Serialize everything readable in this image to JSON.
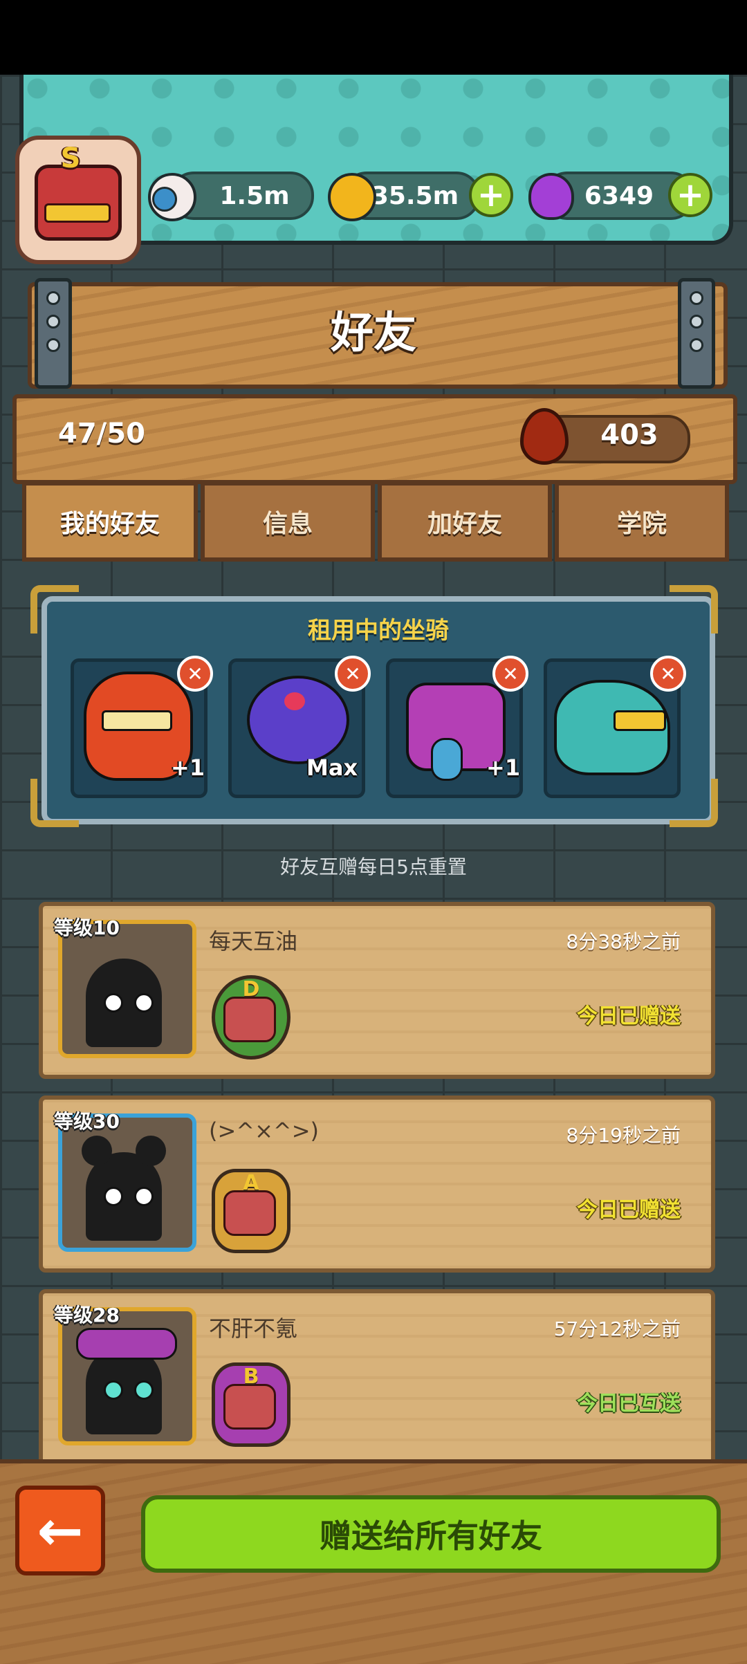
{
  "resources": {
    "eye_value": "1.5m",
    "gold_value": "35.5m",
    "potion_value": "6349"
  },
  "player": {
    "rank": "S"
  },
  "header": {
    "title": "好友"
  },
  "friends_count": "47/50",
  "blood_value": "403",
  "tabs": [
    {
      "label": "我的好友",
      "active": true
    },
    {
      "label": "信息",
      "active": false
    },
    {
      "label": "加好友",
      "active": false
    },
    {
      "label": "学院",
      "active": false
    }
  ],
  "rented_mounts": {
    "title": "租用中的坐骑",
    "mounts": [
      {
        "name": "lion-dance-mount",
        "tag": "+1"
      },
      {
        "name": "purple-rose-mount",
        "tag": "Max"
      },
      {
        "name": "horned-purple-demon-mount",
        "tag": "+1"
      },
      {
        "name": "teal-dragon-mount",
        "tag": ""
      }
    ]
  },
  "reset_note": "好友互赠每日5点重置",
  "friends": [
    {
      "level": "等级10",
      "name": "每天互油",
      "time": "8分38秒之前",
      "status": "今日已赠送",
      "rank": "D",
      "status_color": "#f2e232"
    },
    {
      "level": "等级30",
      "name": "(>^×^>)",
      "time": "8分19秒之前",
      "status": "今日已赠送",
      "rank": "A",
      "status_color": "#f2e232"
    },
    {
      "level": "等级28",
      "name": "不肝不氪",
      "time": "57分12秒之前",
      "status": "今日已互送",
      "rank": "B",
      "status_color": "#9ee05a"
    }
  ],
  "buttons": {
    "back": "←",
    "gift_all": "赠送给所有好友"
  }
}
